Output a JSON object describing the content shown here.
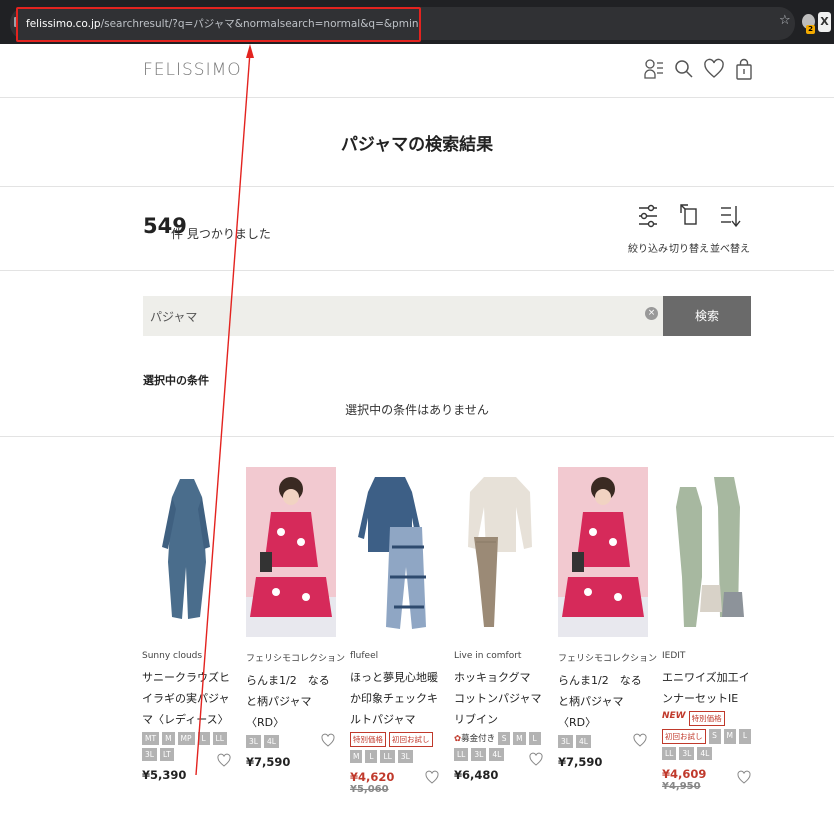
{
  "browser": {
    "url_host": "felissimo.co.jp",
    "url_path": "/searchresult/?q=パジャマ&normalsearch=normal&q=&pmin=&pmax=&size=&shopId="
  },
  "header": {
    "logo": "FELISSIMO"
  },
  "page": {
    "title": "パジャマの検索結果",
    "result_count": "549",
    "result_suffix": "件  見つかりました",
    "tools": [
      {
        "label": "絞り込み",
        "icon": "filter-sliders-icon"
      },
      {
        "label": "切り替え",
        "icon": "toggle-view-icon"
      },
      {
        "label": "並べ替え",
        "icon": "sort-icon"
      }
    ],
    "search": {
      "value": "パジャマ",
      "button": "検索"
    },
    "conditions": {
      "heading": "選択中の条件",
      "none": "選択中の条件はありません"
    }
  },
  "products": [
    {
      "brand": "Sunny clouds",
      "name": "サニークラウズヒイラギの実パジャマ〈レディース〉",
      "sizes": [
        "MT",
        "M",
        "MP",
        "L",
        "LL",
        "3L",
        "LT"
      ],
      "price": "¥5,390"
    },
    {
      "brand": "フェリシモコレクション",
      "name": "らんま1/2　なると柄パジャマ〈RD〉",
      "sizes": [
        "3L",
        "4L"
      ],
      "price": "¥7,590"
    },
    {
      "brand": "flufeel",
      "name": "ほっと夢見心地暖か印象チェックキルトパジャマ",
      "badges": [
        "特別価格",
        "初回お試し"
      ],
      "sizes": [
        "M",
        "L",
        "LL",
        "3L"
      ],
      "price": "¥4,620",
      "old_price": "¥5,060"
    },
    {
      "brand": "Live in comfort",
      "name": "ホッキョクグマ　コットンパジャマリブイン",
      "donation": "募金付き",
      "sizes": [
        "S",
        "M",
        "L",
        "LL",
        "3L",
        "4L"
      ],
      "price": "¥6,480"
    },
    {
      "brand": "フェリシモコレクション",
      "name": "らんま1/2　なると柄パジャマ〈RD〉",
      "sizes": [
        "3L",
        "4L"
      ],
      "price": "¥7,590"
    },
    {
      "brand": "IEDIT",
      "name": "エニワイズ加工インナーセットIE",
      "new": "NEW",
      "badges": [
        "特別価格",
        "初回お試し"
      ],
      "sizes": [
        "S",
        "M",
        "L",
        "LL",
        "3L",
        "4L"
      ],
      "price": "¥4,609",
      "old_price": "¥4,950"
    }
  ],
  "colors": {
    "accent_red": "#e3231f",
    "sale_red": "#c0392b",
    "button_gray": "#6a6a6a"
  }
}
